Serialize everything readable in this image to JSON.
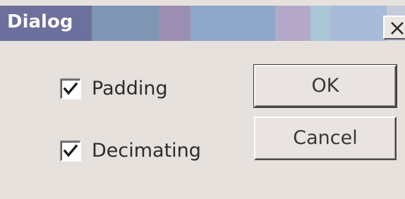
{
  "window": {
    "title": "Dialog"
  },
  "options": [
    {
      "label": "Padding",
      "checked": true
    },
    {
      "label": "Decimating",
      "checked": true
    }
  ],
  "buttons": {
    "ok_label": "OK",
    "cancel_label": "Cancel"
  },
  "icons": {
    "close": "close-icon",
    "check": "checkmark-icon"
  },
  "colors": {
    "dialog_background": "#e7e1de",
    "titlebar": "#7c8db2",
    "title_text": "#ffffff"
  }
}
